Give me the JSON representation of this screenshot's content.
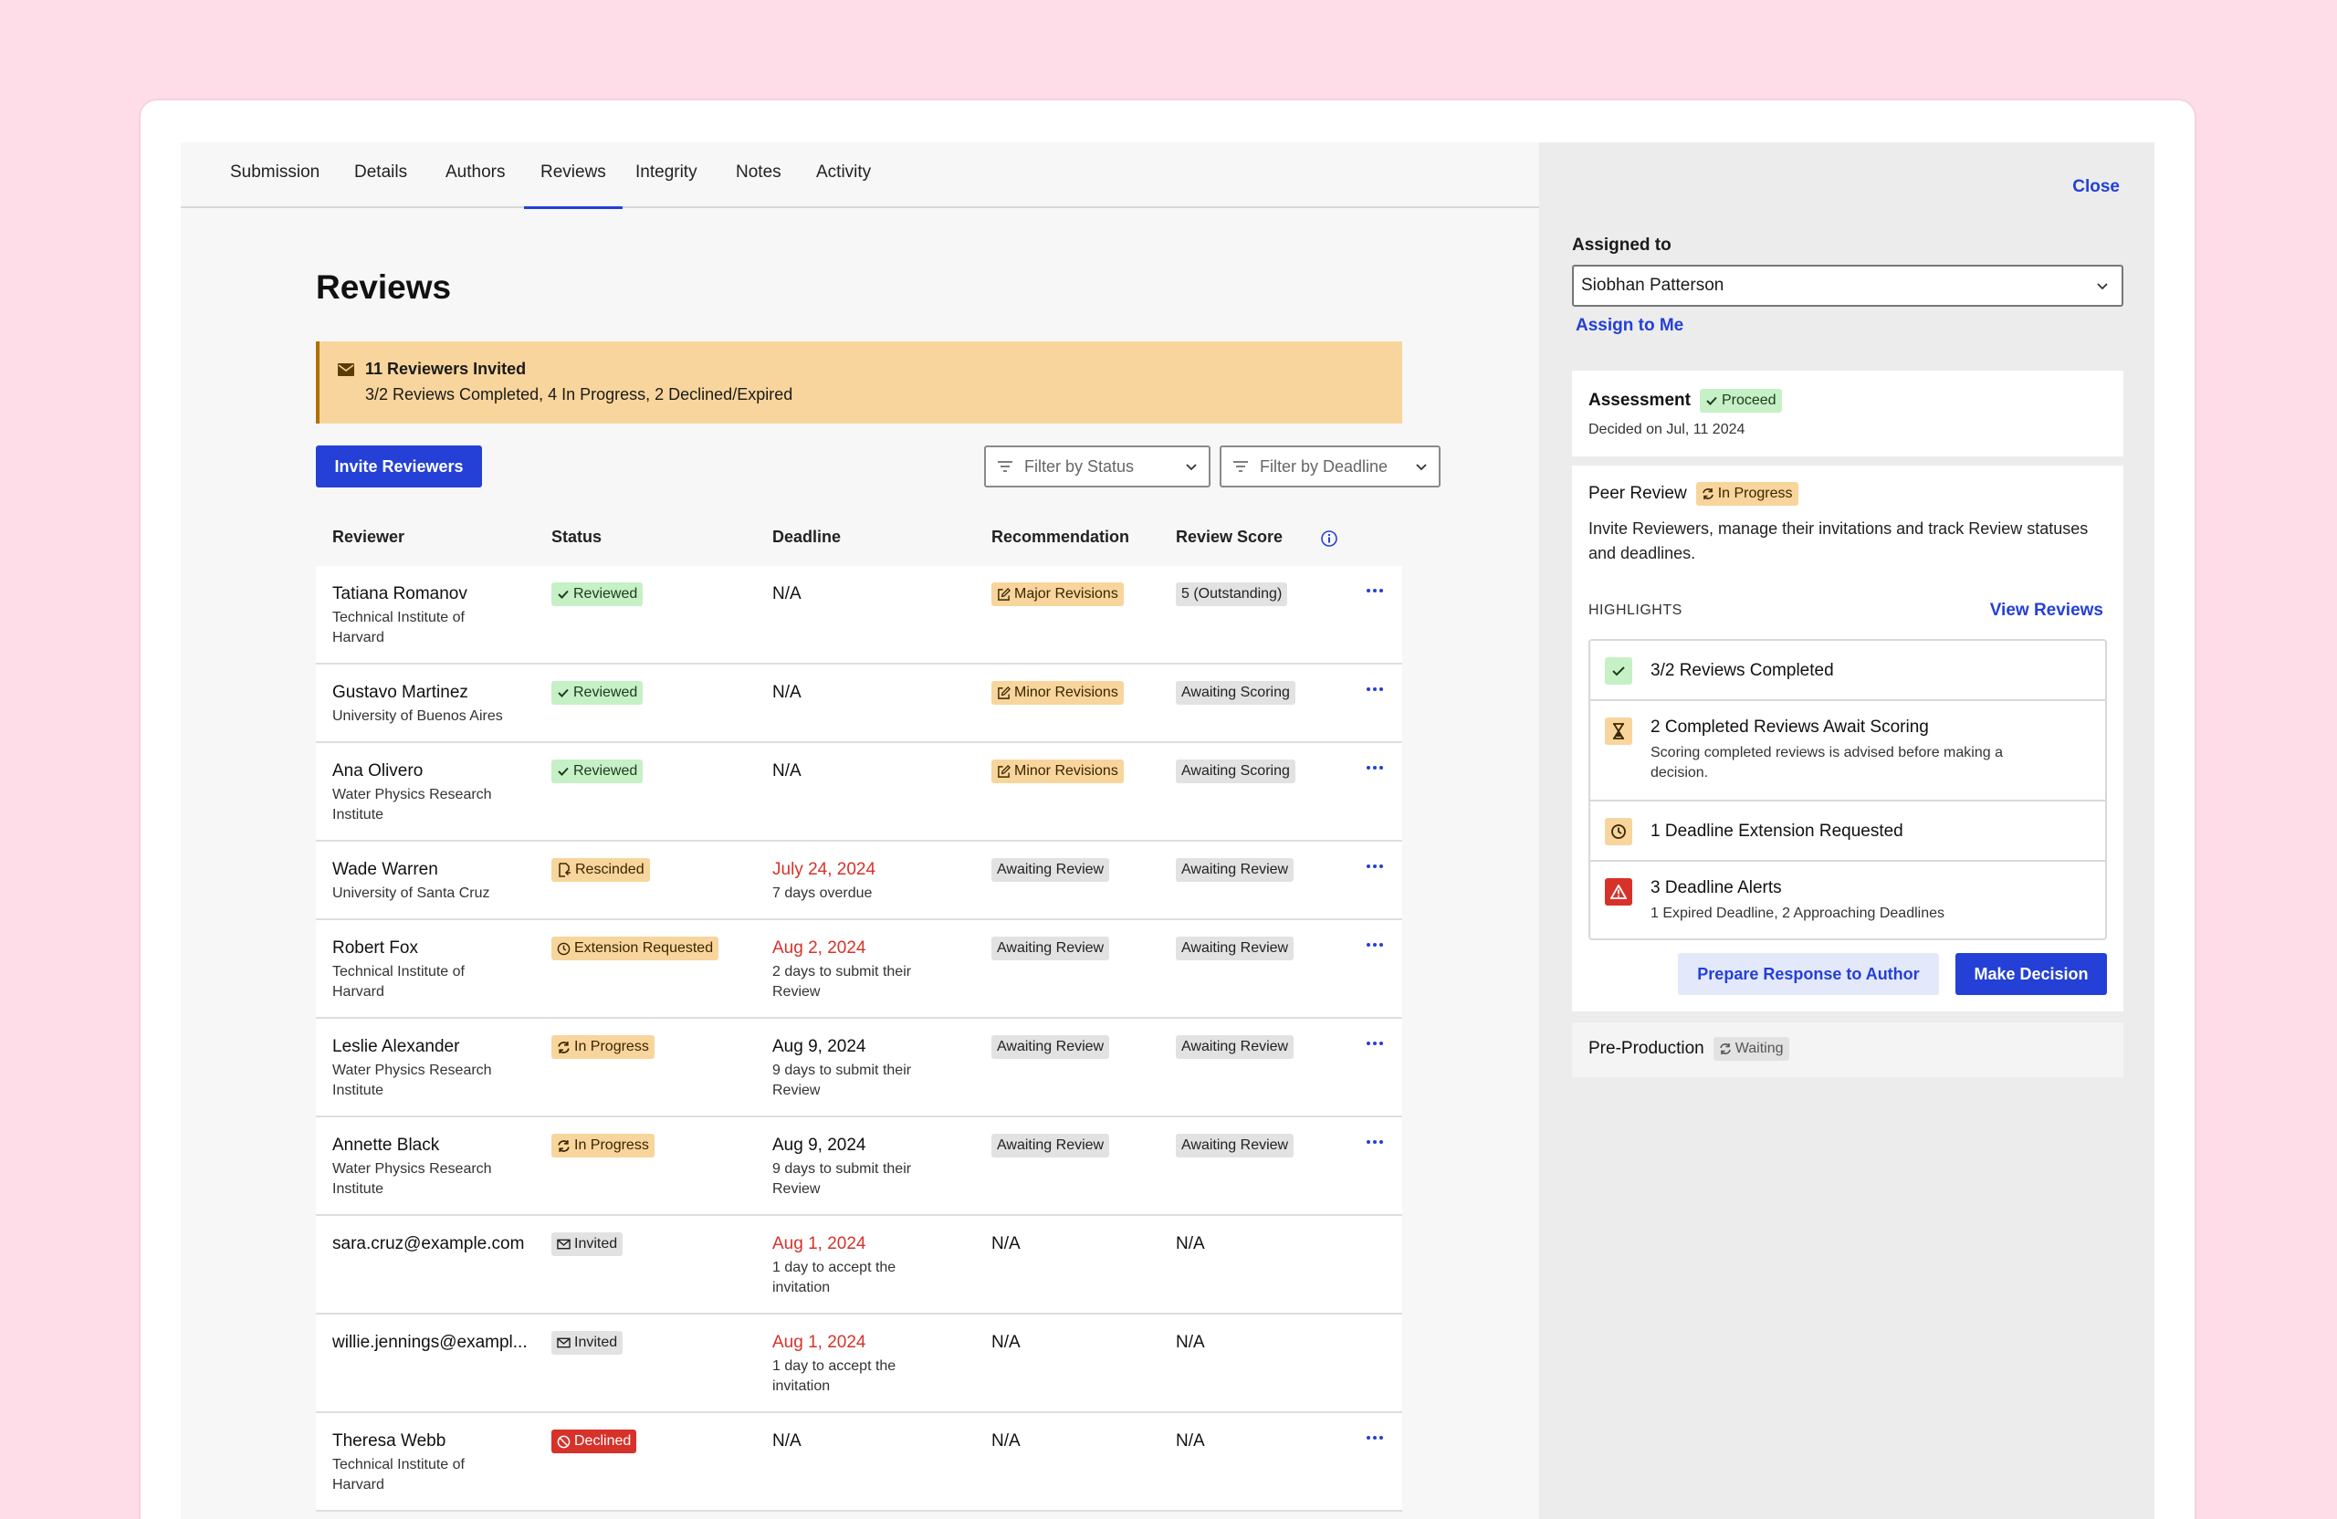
{
  "tabs": [
    "Submission",
    "Details",
    "Authors",
    "Reviews",
    "Integrity",
    "Notes",
    "Activity"
  ],
  "active_tab": "Reviews",
  "page_title": "Reviews",
  "banner": {
    "title": "11 Reviewers Invited",
    "subtitle": "3/2 Reviews Completed, 4 In Progress, 2 Declined/Expired"
  },
  "invite_button": "Invite Reviewers",
  "filters": {
    "status": "Filter by Status",
    "deadline": "Filter by Deadline"
  },
  "table": {
    "headers": [
      "Reviewer",
      "Status",
      "Deadline",
      "Recommendation",
      "Review Score"
    ],
    "rows": [
      {
        "name": "Tatiana Romanov",
        "aff": "Technical Institute of Harvard",
        "status": "Reviewed",
        "status_type": "green",
        "status_icon": "check",
        "deadline": "N/A",
        "deadline_red": false,
        "deadline_sub": "",
        "rec": "Major Revisions",
        "rec_type": "orange",
        "score": "5 (Outstanding)",
        "more": true,
        "height": 108
      },
      {
        "name": "Gustavo Martinez",
        "aff": "University of Buenos Aires",
        "status": "Reviewed",
        "status_type": "green",
        "status_icon": "check",
        "deadline": "N/A",
        "deadline_red": false,
        "deadline_sub": "",
        "rec": "Minor Revisions",
        "rec_type": "orange",
        "score": "Awaiting Scoring",
        "more": true,
        "height": 86
      },
      {
        "name": "Ana Olivero",
        "aff": "Water Physics Research Institute",
        "status": "Reviewed",
        "status_type": "green",
        "status_icon": "check",
        "deadline": "N/A",
        "deadline_red": false,
        "deadline_sub": "",
        "rec": "Minor Revisions",
        "rec_type": "orange",
        "score": "Awaiting Scoring",
        "more": true,
        "height": 108
      },
      {
        "name": "Wade Warren",
        "aff": "University of Santa Cruz",
        "status": "Rescinded",
        "status_type": "orange",
        "status_icon": "rescind",
        "deadline": "July 24, 2024",
        "deadline_red": true,
        "deadline_sub": "7 days overdue",
        "rec": "Awaiting Review",
        "rec_type": "gray",
        "score": "Awaiting Review",
        "more": true,
        "height": 86
      },
      {
        "name": "Robert Fox",
        "aff": "Technical Institute of Harvard",
        "status": "Extension Requested",
        "status_type": "orange",
        "status_icon": "clock",
        "deadline": "Aug 2, 2024",
        "deadline_red": true,
        "deadline_sub": "2 days to submit their Review",
        "rec": "Awaiting Review",
        "rec_type": "gray",
        "score": "Awaiting Review",
        "more": true,
        "height": 108
      },
      {
        "name": "Leslie Alexander",
        "aff": "Water Physics Research Institute",
        "status": "In Progress",
        "status_type": "orange",
        "status_icon": "sync",
        "deadline": "Aug 9, 2024",
        "deadline_red": false,
        "deadline_sub": "9 days to submit their Review",
        "rec": "Awaiting Review",
        "rec_type": "gray",
        "score": "Awaiting Review",
        "more": true,
        "height": 108
      },
      {
        "name": "Annette Black",
        "aff": "Water Physics Research Institute",
        "status": "In Progress",
        "status_type": "orange",
        "status_icon": "sync",
        "deadline": "Aug 9, 2024",
        "deadline_red": false,
        "deadline_sub": "9 days to submit their Review",
        "rec": "Awaiting Review",
        "rec_type": "gray",
        "score": "Awaiting Review",
        "more": true,
        "height": 108
      },
      {
        "name": "sara.cruz@example.com",
        "aff": "",
        "status": "Invited",
        "status_type": "gray",
        "status_icon": "mail",
        "deadline": "Aug 1, 2024",
        "deadline_red": true,
        "deadline_sub": "1 day to accept the invitation",
        "rec": "N/A",
        "rec_type": "plain",
        "score": "N/A",
        "more": false,
        "height": 108
      },
      {
        "name": "willie.jennings@exampl...",
        "aff": "",
        "status": "Invited",
        "status_type": "gray",
        "status_icon": "mail",
        "deadline": "Aug 1, 2024",
        "deadline_red": true,
        "deadline_sub": "1 day to accept the invitation",
        "rec": "N/A",
        "rec_type": "plain",
        "score": "N/A",
        "more": false,
        "height": 108
      },
      {
        "name": "Theresa Webb",
        "aff": "Technical Institute of Harvard",
        "status": "Declined",
        "status_type": "red",
        "status_icon": "ban",
        "deadline": "N/A",
        "deadline_red": false,
        "deadline_sub": "",
        "rec": "N/A",
        "rec_type": "plain",
        "score": "N/A",
        "more": true,
        "height": 108
      }
    ]
  },
  "side": {
    "close": "Close",
    "assigned_label": "Assigned to",
    "assignee": "Siobhan Patterson",
    "assign_me": "Assign to Me",
    "assessment": {
      "title": "Assessment",
      "badge": "Proceed",
      "decided": "Decided on Jul, 11 2024"
    },
    "peer_review": {
      "title": "Peer Review",
      "badge": "In Progress",
      "description": "Invite Reviewers, manage their invitations and track Review statuses and deadlines.",
      "highlights_label": "HIGHLIGHTS",
      "view_reviews": "View Reviews",
      "highlights": [
        {
          "title": "3/2 Reviews Completed",
          "sub": "",
          "icon": "check"
        },
        {
          "title": "2 Completed Reviews Await Scoring",
          "sub": "Scoring completed reviews is advised before making a decision.",
          "icon": "hourglass"
        },
        {
          "title": "1 Deadline Extension Requested",
          "sub": "",
          "icon": "clock"
        },
        {
          "title": "3 Deadline Alerts",
          "sub": "1 Expired Deadline, 2 Approaching Deadlines",
          "icon": "alert"
        }
      ],
      "prepare_button": "Prepare Response to Author",
      "decision_button": "Make Decision"
    },
    "pre_production": {
      "title": "Pre-Production",
      "badge": "Waiting"
    }
  },
  "colors": {
    "accent": "#2440d6",
    "warning_bg": "#f8d59c",
    "success_bg": "#c6f0c6",
    "danger": "#d6322a",
    "page_bg": "#ffdde8"
  }
}
